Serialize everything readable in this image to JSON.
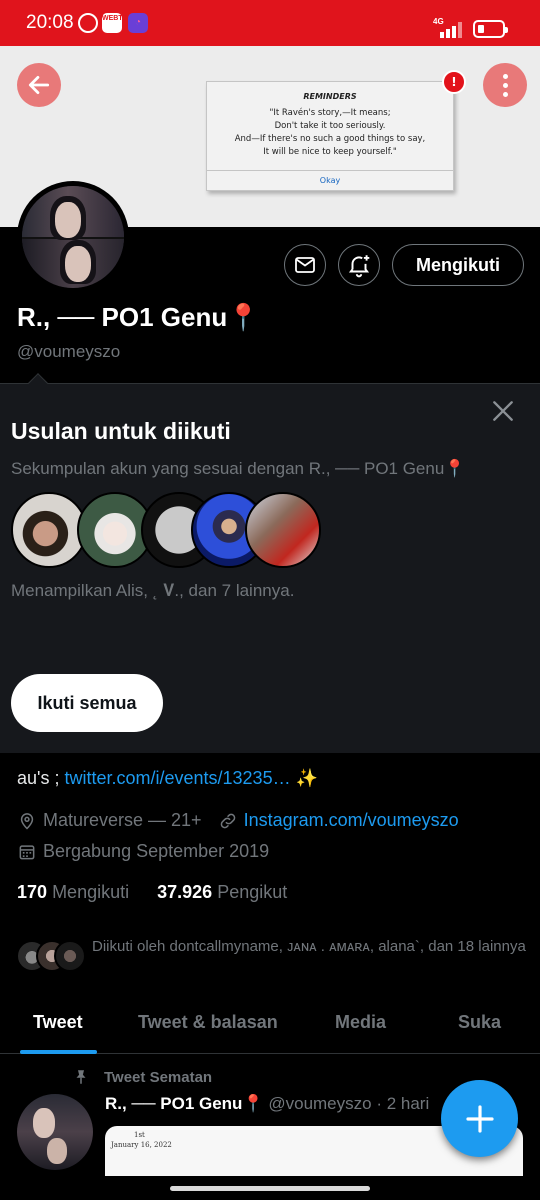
{
  "status_bar": {
    "time": "20:08",
    "app_icon_text": "WEBTOON",
    "network": "4G",
    "battery_percent": 25
  },
  "reminder": {
    "title": "REMINDERS",
    "line1": "\"It Ravén's story,—It means;",
    "line2": "Don't take it too seriously.",
    "line3": "And—If there's no such a good things to say,",
    "line4": "It will be nice to keep yourself.\"",
    "ok_label": "Okay",
    "alert_badge": "!"
  },
  "profile": {
    "name": "R., ── PO1 Genu📍",
    "handle": "@voumeyszo",
    "follow_state_label": "Mengikuti"
  },
  "suggestions": {
    "title": "Usulan untuk diikuti",
    "description": "Sekumpulan akun yang sesuai dengan R., ── PO1 Genu📍",
    "footer": "Menampilkan Alis, ˛ 𝐕., dan 7 lainnya.",
    "follow_all_label": "Ikuti semua"
  },
  "bio": {
    "prefix": "au's ; ",
    "link": "twitter.com/i/events/13235…",
    "emoji": " ✨",
    "location": "Matureverse — 21+",
    "website": "Instagram.com/voumeyszo",
    "joined": "Bergabung September 2019"
  },
  "stats": {
    "following_count": "170",
    "following_label": "Mengikuti",
    "followers_count": "37.926",
    "followers_label": "Pengikut"
  },
  "followed_by": {
    "text": "Diikuti oleh dontcallmyname, ᴊᴀɴᴀ . ᴀᴍᴀʀᴀ, alana`, dan 18 lainnya"
  },
  "tabs": [
    "Tweet",
    "Tweet & balasan",
    "Media",
    "Suka"
  ],
  "pinned_tweet": {
    "label": "Tweet Sematan",
    "author": "R., ── PO1 Genu📍",
    "meta": "@voumeyszo · 2 hari",
    "card_line1": "1st",
    "card_line2": "January 16, 2022"
  },
  "colors": {
    "status_bar": "#e0141c",
    "banner_button": "#e87979",
    "accent": "#1d9bf0",
    "background": "#000000",
    "panel": "#16181c"
  }
}
